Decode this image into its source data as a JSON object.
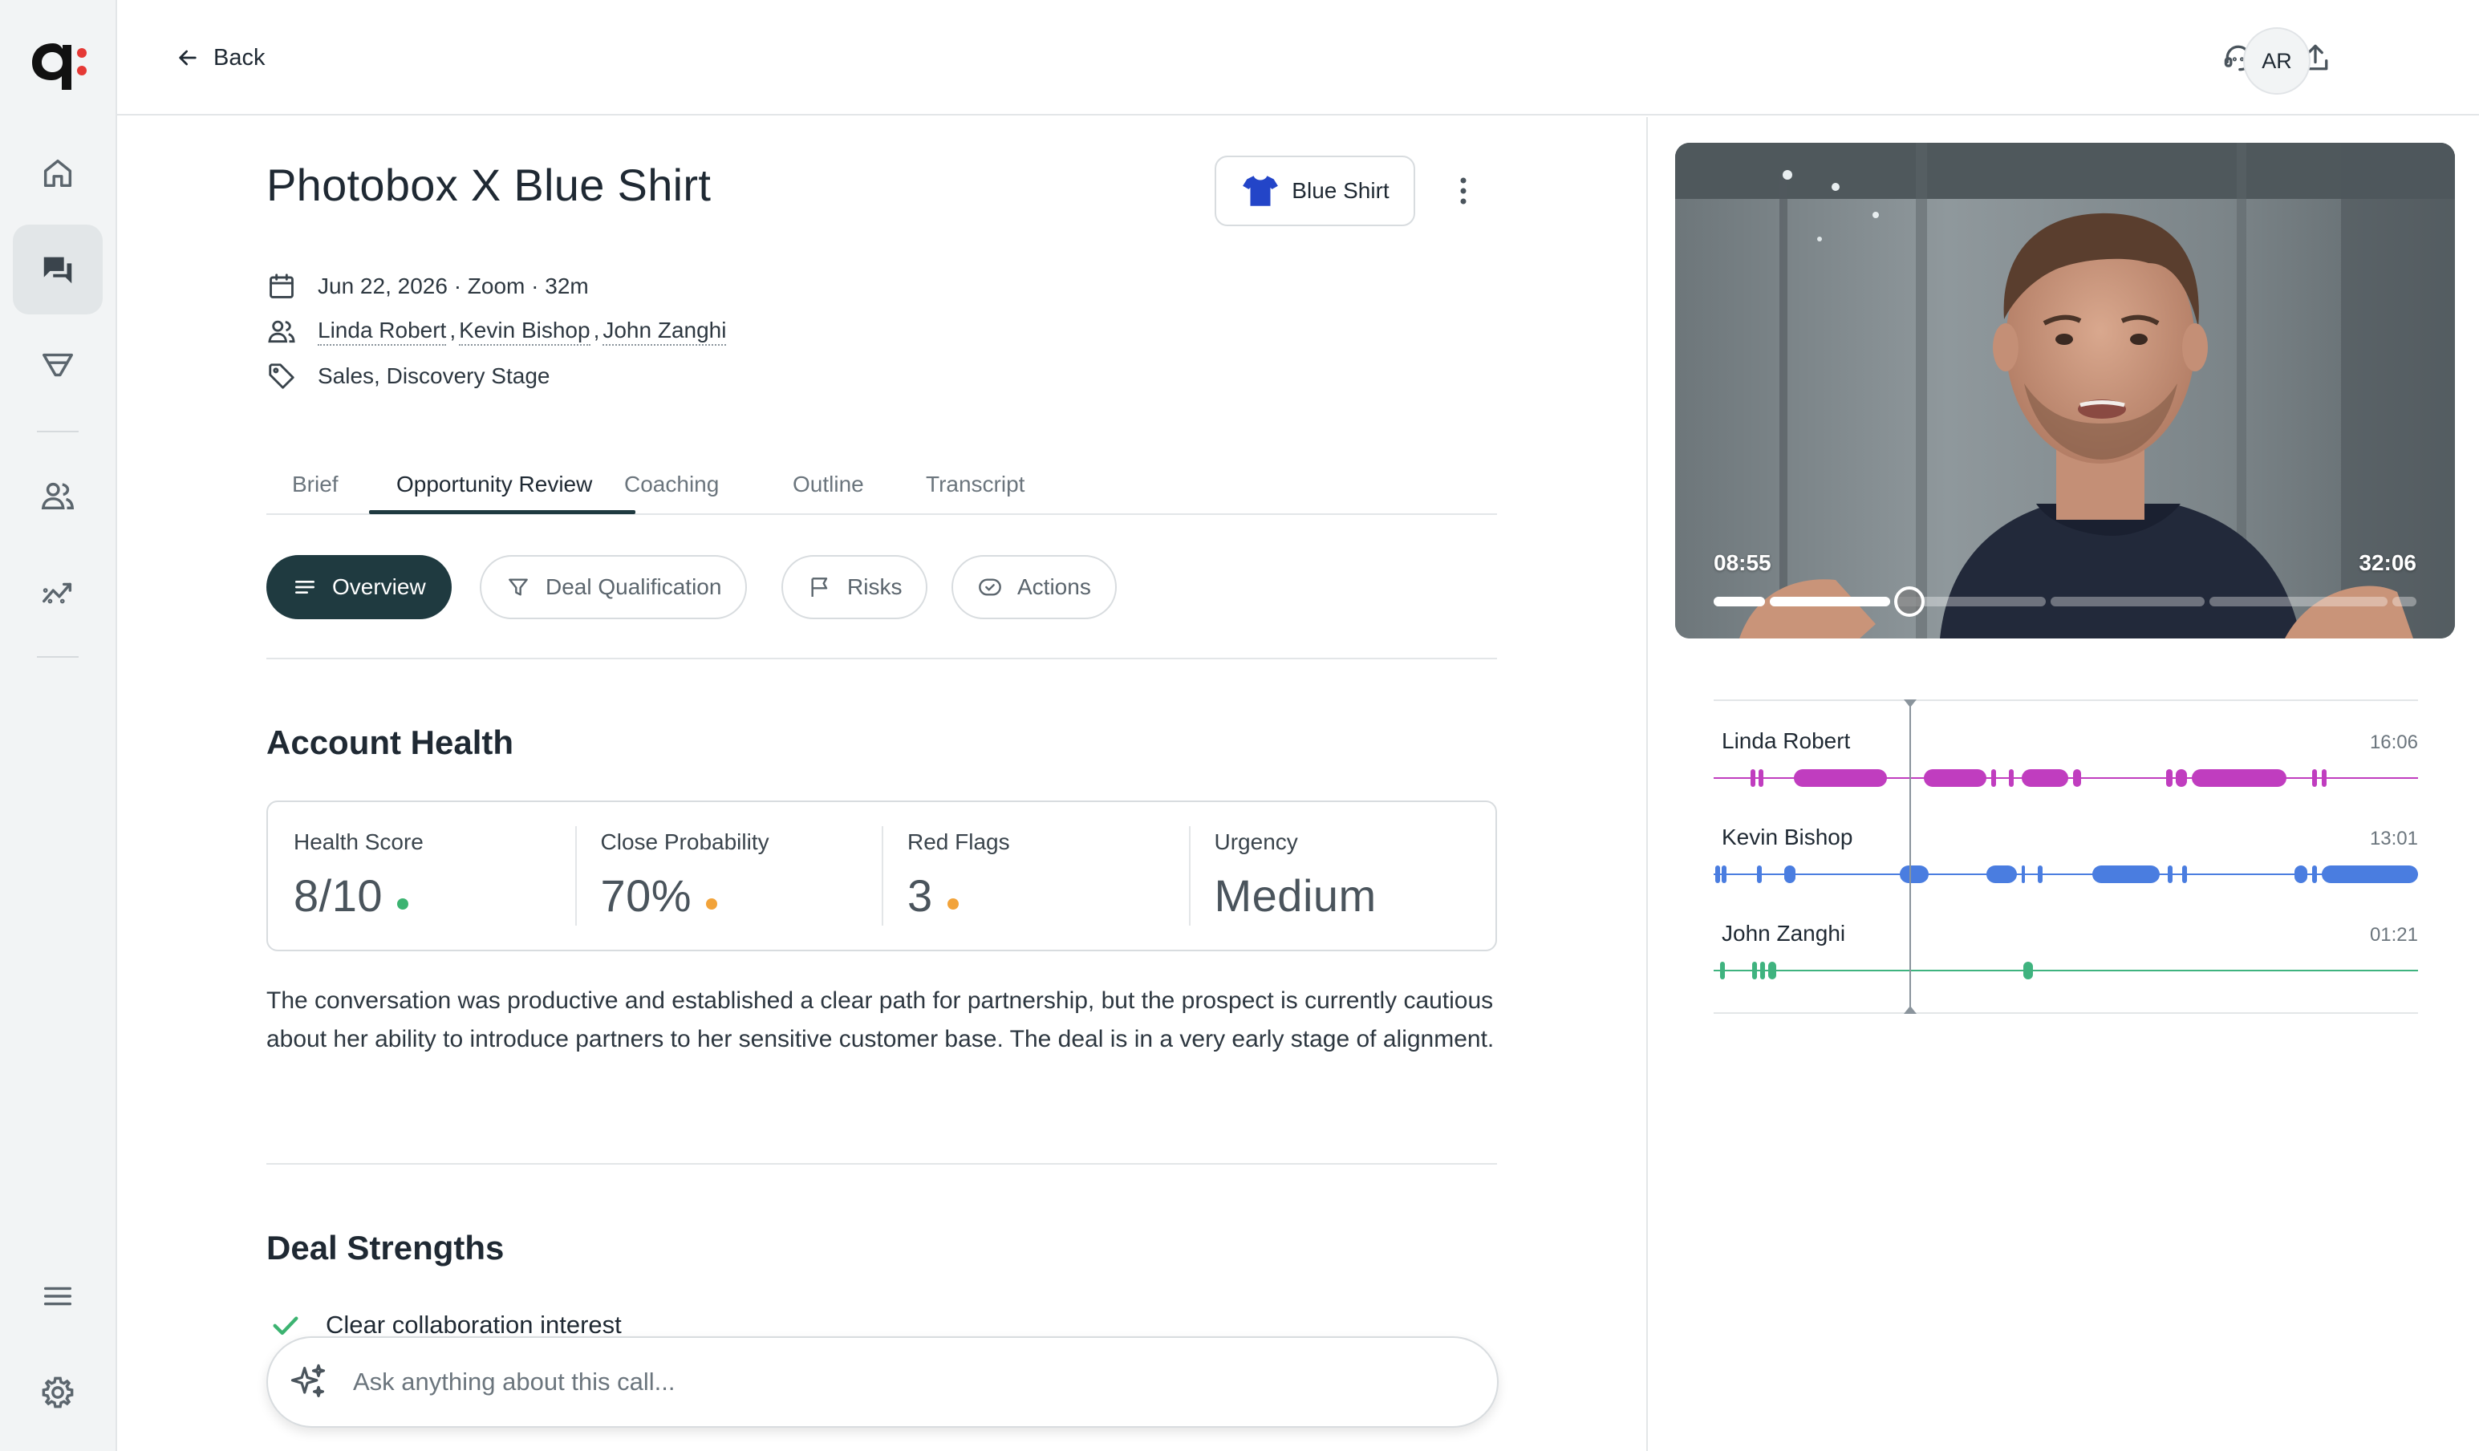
{
  "app": {
    "icons": [
      "logo",
      "home-icon",
      "chat-icon",
      "filter-icon",
      "users-icon",
      "analytics-icon",
      "menu-icon",
      "gear-icon"
    ],
    "accent": "#1f3a40",
    "logo_dot_color": "#e53935"
  },
  "topbar": {
    "back_label": "Back",
    "avatar_initials": "AR"
  },
  "call": {
    "title": "Photobox X Blue Shirt",
    "tag_label": "Blue Shirt",
    "date_line": "Jun 22, 2026 · Zoom · 32m",
    "participants": [
      "Linda Robert",
      "Kevin Bishop",
      "John Zanghi"
    ],
    "labels_line": "Sales, Discovery Stage"
  },
  "tabs": [
    "Brief",
    "Opportunity Review",
    "Coaching",
    "Outline",
    "Transcript"
  ],
  "active_tab": "Opportunity Review",
  "subtabs": [
    "Overview",
    "Deal Qualification",
    "Risks",
    "Actions"
  ],
  "active_subtab": "Overview",
  "account_health": {
    "title": "Account Health",
    "metrics": [
      {
        "label": "Health Score",
        "value": "8/10",
        "status_color": "#3cb371"
      },
      {
        "label": "Close Probability",
        "value": "70%",
        "status_color": "#f2a33a"
      },
      {
        "label": "Red Flags",
        "value": "3",
        "status_color": "#f2a33a"
      },
      {
        "label": "Urgency",
        "value": "Medium",
        "status_color": ""
      }
    ],
    "summary": "The conversation was productive and established a clear path for partnership, but the prospect is currently cautious about her ability to introduce partners to her sensitive customer base. The deal is in a very early stage of alignment."
  },
  "deal_strengths": {
    "title": "Deal Strengths",
    "items": [
      "Clear collaboration interest"
    ]
  },
  "ask": {
    "placeholder": "Ask anything about this call..."
  },
  "video": {
    "current_time": "08:55",
    "total_time": "32:06",
    "progress_fraction": 0.278
  },
  "speakers": [
    {
      "name": "Linda Robert",
      "duration": "16:06",
      "color": "#c03dbf"
    },
    {
      "name": "Kevin Bishop",
      "duration": "13:01",
      "color": "#4a7de0"
    },
    {
      "name": "John Zanghi",
      "duration": "01:21",
      "color": "#3fb37f"
    }
  ]
}
